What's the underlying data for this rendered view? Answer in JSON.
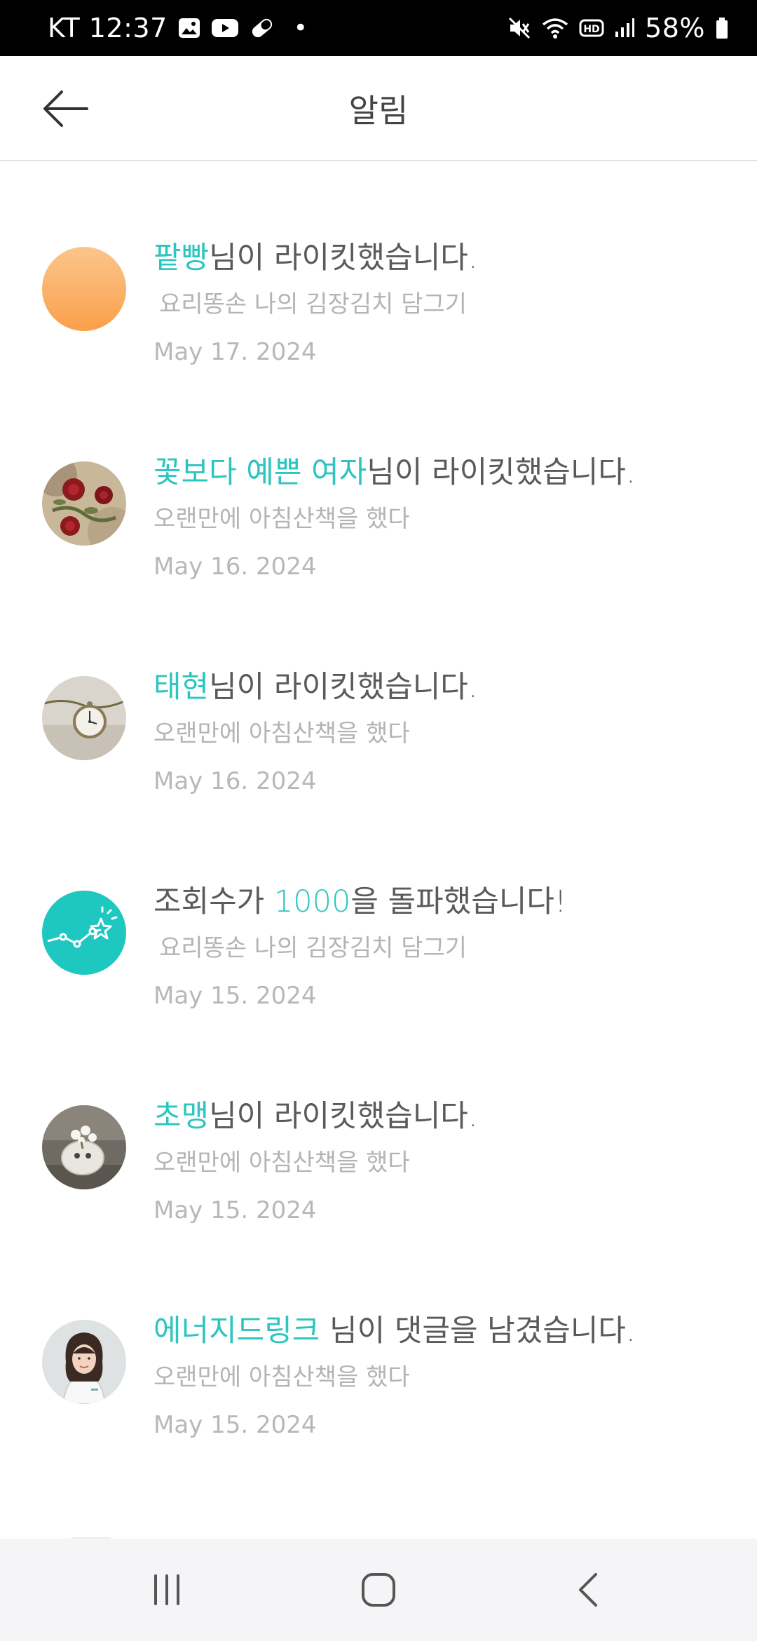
{
  "status_bar": {
    "carrier_time": "KT 12:37",
    "battery": "58%",
    "icons_left": [
      "gallery-icon",
      "youtube-icon",
      "pill-icon",
      "dot-icon"
    ],
    "icons_right": [
      "mute-icon",
      "wifi-icon",
      "hd-icon",
      "signal-icon",
      "battery-icon"
    ]
  },
  "app_bar": {
    "title": "알림",
    "back_icon": "arrow-left-icon"
  },
  "notifications": [
    {
      "name": "팥빵",
      "suffix": "님이 라이킷했습니다.",
      "post": "요리똥손 나의 김장김치 담그기",
      "date": "May 17. 2024",
      "avatar": "orange-gradient"
    },
    {
      "name": "꽃보다 예쁜 여자",
      "suffix": "님이 라이킷했습니다.",
      "post": "오랜만에 아침산책을 했다",
      "date": "May 16. 2024",
      "avatar": "roses-photo"
    },
    {
      "name": "태현",
      "suffix": "님이 라이킷했습니다.",
      "post": "오랜만에 아침산책을 했다",
      "date": "May 16. 2024",
      "avatar": "pocket-watch-photo"
    },
    {
      "prefix": "조회수가 ",
      "highlight": "1000",
      "suffix": "을 돌파했습니다!",
      "post": "요리똥손 나의 김장김치 담그기",
      "date": "May 15. 2024",
      "avatar": "views-milestone-icon"
    },
    {
      "name": "초맹",
      "suffix": "님이 라이킷했습니다.",
      "post": "오랜만에 아침산책을 했다",
      "date": "May 15. 2024",
      "avatar": "flower-vase-photo"
    },
    {
      "name": "에너지드링크",
      "suffix": " 님이 댓글을 남겼습니다.",
      "post": "오랜만에 아침산책을 했다",
      "date": "May 15. 2024",
      "avatar": "woman-portrait-photo"
    }
  ],
  "nav_bar": {
    "recents_icon": "recents-icon",
    "home_icon": "home-icon",
    "back_icon": "back-chevron-icon"
  },
  "colors": {
    "accent": "#2cc5c0",
    "title_text": "#5a5a5a",
    "secondary_text": "#b4b4b4",
    "status_bar_bg": "#000000",
    "nav_bar_bg": "#f5f5f7"
  }
}
